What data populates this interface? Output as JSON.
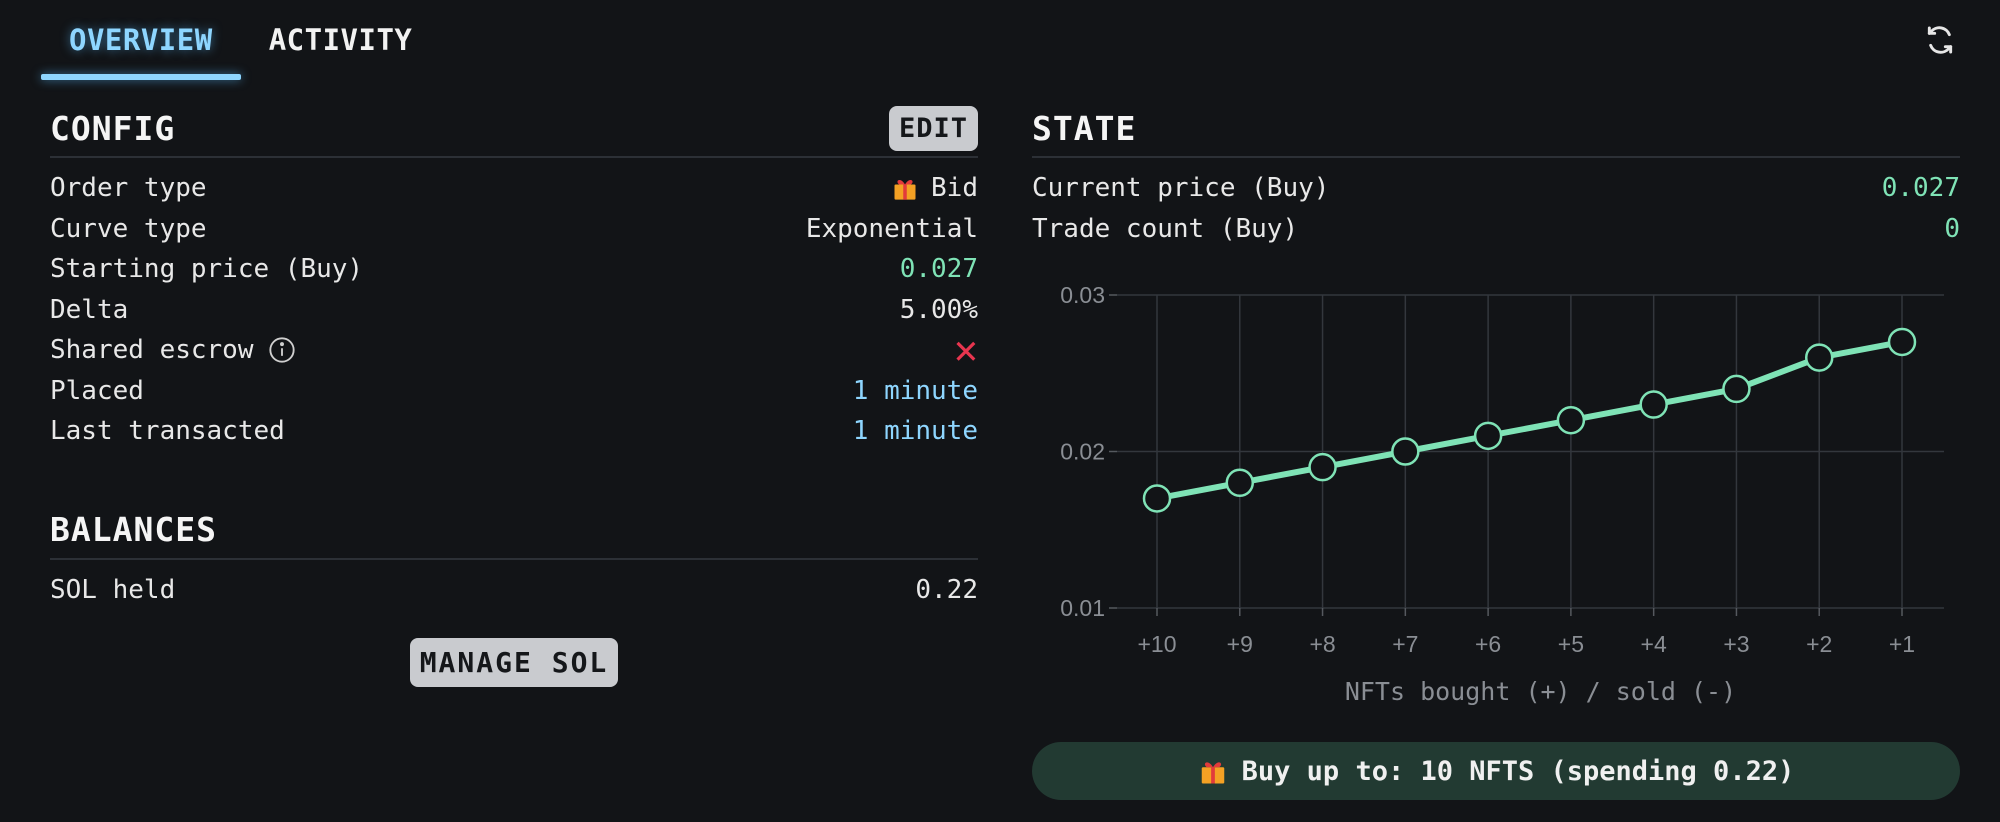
{
  "tabs": [
    {
      "label": "OVERVIEW",
      "active": true
    },
    {
      "label": "ACTIVITY",
      "active": false
    }
  ],
  "icons": {
    "refresh": "refresh-icon",
    "gift": "gift-icon",
    "info": "info-icon",
    "cross": "cross-icon"
  },
  "colors": {
    "accent_blue": "#8ed6ff",
    "accent_green": "#7fe3b6",
    "error_red": "#e8354f",
    "background": "#121417",
    "pill_background": "#223a32"
  },
  "config": {
    "title": "CONFIG",
    "edit_label": "EDIT",
    "rows": [
      {
        "label": "Order type",
        "value": "Bid"
      },
      {
        "label": "Curve type",
        "value": "Exponential"
      },
      {
        "label": "Starting price (Buy)",
        "value": "0.027"
      },
      {
        "label": "Delta",
        "value": "5.00%"
      },
      {
        "label": "Shared escrow",
        "value": "✕"
      },
      {
        "label": "Placed",
        "value": "1 minute"
      },
      {
        "label": "Last transacted",
        "value": "1 minute"
      }
    ]
  },
  "balances": {
    "title": "BALANCES",
    "rows": [
      {
        "label": "SOL held",
        "value": "0.22"
      }
    ],
    "manage_label": "MANAGE SOL"
  },
  "state": {
    "title": "STATE",
    "rows": [
      {
        "label": "Current price (Buy)",
        "value": "0.027"
      },
      {
        "label": "Trade count (Buy)",
        "value": "0"
      }
    ]
  },
  "chart_data": {
    "type": "line",
    "categories": [
      "+10",
      "+9",
      "+8",
      "+7",
      "+6",
      "+5",
      "+4",
      "+3",
      "+2",
      "+1"
    ],
    "values": [
      0.017,
      0.018,
      0.019,
      0.02,
      0.021,
      0.022,
      0.023,
      0.024,
      0.026,
      0.027
    ],
    "xlabel": "NFTs bought (+) / sold (-)",
    "ylabel": "",
    "ylim": [
      0.01,
      0.03
    ],
    "yticks": [
      "0.01",
      "0.02",
      "0.03"
    ],
    "grid": true,
    "line_color": "#7fe3b6"
  },
  "footer": {
    "text": "Buy up to: 10 NFTS (spending 0.22)"
  }
}
